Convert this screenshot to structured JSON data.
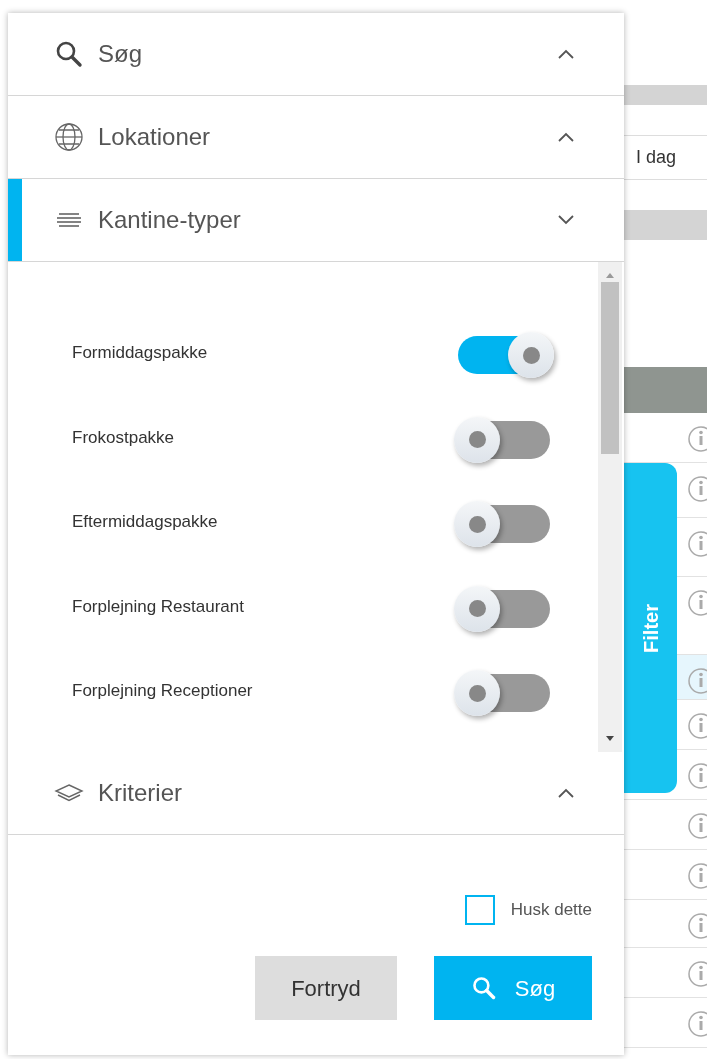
{
  "sections_top": [
    {
      "title": "Søg",
      "expanded": false
    },
    {
      "title": "Lokationer",
      "expanded": false
    },
    {
      "title": "Kantine-typer",
      "expanded": true
    }
  ],
  "toggles": [
    {
      "label": "Formiddagspakke",
      "on": true
    },
    {
      "label": "Frokostpakke",
      "on": false
    },
    {
      "label": "Eftermiddagspakke",
      "on": false
    },
    {
      "label": "Forplejning Restaurant",
      "on": false
    },
    {
      "label": "Forplejning Receptioner",
      "on": false
    }
  ],
  "sections_bottom": [
    {
      "title": "Kriterier",
      "expanded": false
    }
  ],
  "remember": {
    "label": "Husk dette",
    "checked": false
  },
  "buttons": [
    {
      "label": "Fortryd",
      "kind": "secondary"
    },
    {
      "label": "Søg",
      "kind": "primary"
    }
  ],
  "background": {
    "date_cell": "I dag",
    "filter_tab": "Filter",
    "rows": [
      {
        "selected": false
      },
      {
        "selected": false
      },
      {
        "selected": false
      },
      {
        "selected": false
      },
      {
        "selected": true
      },
      {
        "selected": false
      },
      {
        "selected": false
      },
      {
        "selected": false
      },
      {
        "selected": false
      },
      {
        "selected": false
      },
      {
        "selected": false
      },
      {
        "selected": false
      }
    ]
  }
}
